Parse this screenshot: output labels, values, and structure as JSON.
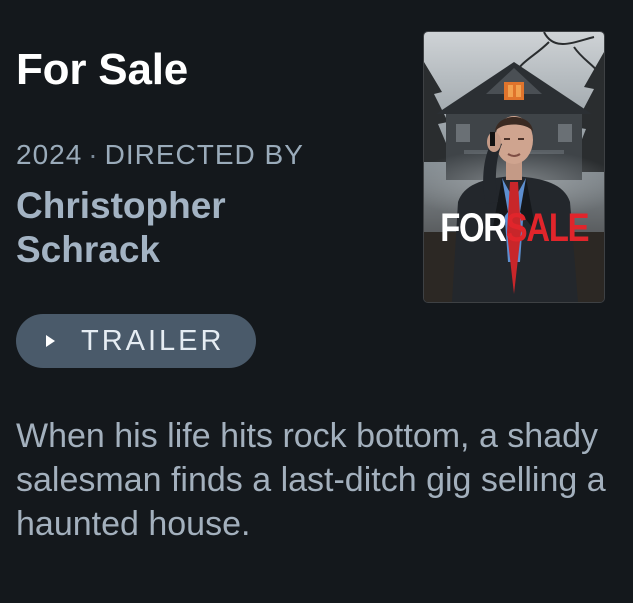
{
  "film": {
    "title": "For Sale",
    "year": "2024",
    "separator": "·",
    "directed_by_label": "DIRECTED BY",
    "director_line1": "Christopher",
    "director_line2": "Schrack",
    "trailer_label": "TRAILER",
    "synopsis": "When his life hits rock bottom, a shady salesman finds a last-ditch gig selling a haunted house."
  },
  "poster": {
    "title_part1": "FOR",
    "title_part2": "SALE"
  },
  "colors": {
    "background": "#14181c",
    "title": "#ffffff",
    "muted_text": "#9aabba",
    "button_bg": "#4a5a6a",
    "poster_accent": "#e1252b"
  },
  "icons": {
    "trailer": "play-icon"
  }
}
